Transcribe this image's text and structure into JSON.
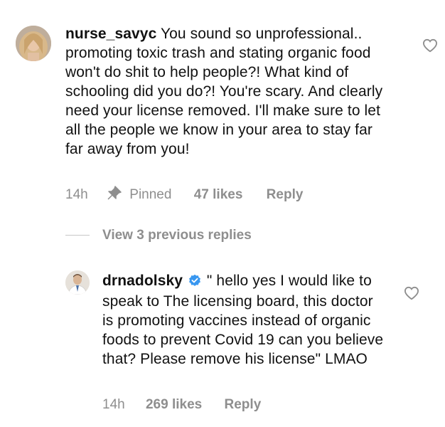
{
  "comments": [
    {
      "username": "nurse_savyc",
      "text": "You sound so unprofessional.. promoting toxic trash and stating organic food won't do shit to help people?! What kind of schooling did you do?! You're scary. And clearly need your license removed. I'll make sure to let all the people we know in your area to stay far far away from you!",
      "time": "14h",
      "pinned_label": "Pinned",
      "likes": "47 likes",
      "reply_label": "Reply",
      "icons": {
        "like": "heart-outline-icon",
        "pin": "pin-icon"
      }
    },
    {
      "username": "drnadolsky",
      "verified": true,
      "text": "\" hello yes I would like to speak to The licensing board, this doctor is promoting vaccines instead of organic foods to prevent Covid 19 can you believe that? Please remove his license\" LMAO",
      "time": "14h",
      "likes": "269 likes",
      "reply_label": "Reply",
      "icons": {
        "like": "heart-outline-icon",
        "verified": "verified-badge-icon"
      }
    }
  ],
  "view_replies_label": "View 3 previous replies",
  "colors": {
    "meta_gray": "#8e8e8e",
    "verified_blue": "#3897f0",
    "text": "#111111"
  }
}
